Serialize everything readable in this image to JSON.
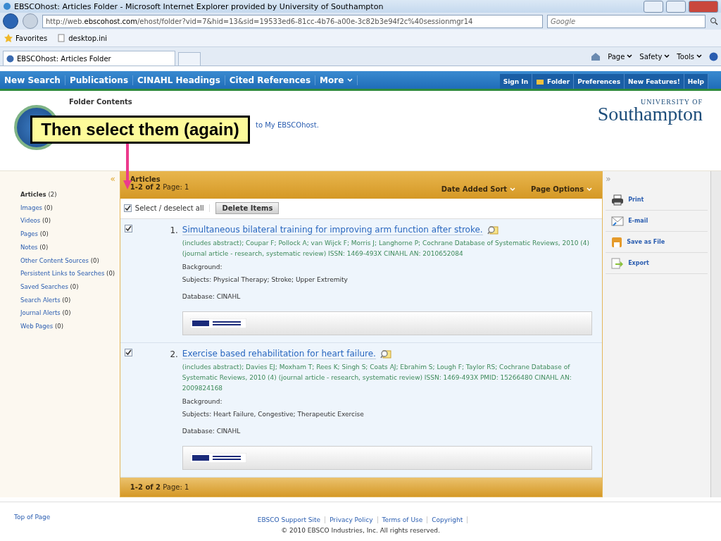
{
  "window": {
    "title": "EBSCOhost: Articles Folder - Microsoft Internet Explorer provided by University of Southampton"
  },
  "address_bar": {
    "url": "http://web.**ebscohost.com**/ehost/folder?vid=7&hid=13&sid=19533ed6-81cc-4b76-a00e-3c82b3e94f2c%40sessionmgr14"
  },
  "search_box": {
    "placeholder": "Google"
  },
  "favorites_bar": {
    "favorites": "Favorites",
    "items": [
      "desktop.ini"
    ]
  },
  "tab": {
    "label": "EBSCOhost: Articles Folder"
  },
  "command_bar": [
    "Page",
    "Safety",
    "Tools"
  ],
  "nav": {
    "items": [
      "New Search",
      "Publications",
      "CINAHL Headings",
      "Cited References",
      "More"
    ],
    "right_items": [
      {
        "label": "Sign In",
        "icon": false
      },
      {
        "label": "Folder",
        "icon": true
      },
      {
        "label": "Preferences",
        "icon": false
      },
      {
        "label": "New Features!",
        "icon": false
      },
      {
        "label": "Help",
        "icon": false
      }
    ]
  },
  "header": {
    "title": "Folder Contents",
    "text": "to My EBSCOhost.",
    "logo_top": "UNIVERSITY OF",
    "logo_name": "Southampton"
  },
  "callout": {
    "text": "Then select them (again)"
  },
  "sidebar": {
    "collapse": "«",
    "items": [
      {
        "label": "Articles",
        "count": "(2)",
        "selected": true
      },
      {
        "label": "Images",
        "count": "(0)",
        "selected": false
      },
      {
        "label": "Videos",
        "count": "(0)",
        "selected": false
      },
      {
        "label": "Pages",
        "count": "(0)",
        "selected": false
      },
      {
        "label": "Notes",
        "count": "(0)",
        "selected": false
      },
      {
        "label": "Other Content Sources",
        "count": "(0)",
        "selected": false
      },
      {
        "label": "Persistent Links to Searches",
        "count": "(0)",
        "selected": false
      },
      {
        "label": "Saved Searches",
        "count": "(0)",
        "selected": false
      },
      {
        "label": "Search Alerts",
        "count": "(0)",
        "selected": false
      },
      {
        "label": "Journal Alerts",
        "count": "(0)",
        "selected": false
      },
      {
        "label": "Web Pages",
        "count": "(0)",
        "selected": false
      }
    ]
  },
  "results": {
    "title": "Articles",
    "range": "**1-2 of 2** Page: 1",
    "sort": "Date Added Sort",
    "page_options": "Page Options",
    "select_all": {
      "label": "Select / deselect all",
      "checked": true
    },
    "delete": "Delete Items",
    "items": [
      {
        "number": "1.",
        "title": "Simultaneous bilateral training for improving arm function after stroke.",
        "checked": true,
        "meta": "(includes abstract); Coupar F; Pollock A; van Wijck F; Morris J; Langhorne P; Cochrane Database of Systematic Reviews, 2010 (4) (journal article - research, systematic review) ISSN: 1469-493X CINAHL AN: 2010652084",
        "background": "Background:",
        "subjects": "Subjects: Physical Therapy; Stroke; Upper Extremity",
        "database": "Database: CINAHL"
      },
      {
        "number": "2.",
        "title": "Exercise based rehabilitation for heart failure.",
        "checked": true,
        "meta": "(includes abstract); Davies EJ; Moxham T; Rees K; Singh S; Coats AJ; Ebrahim S; Lough F; Taylor RS; Cochrane Database of Systematic Reviews, 2010 (4) (journal article - research, systematic review) ISSN: 1469-493X PMID: 15266480 CINAHL AN: 2009824168",
        "background": "Background:",
        "subjects": "Subjects: Heart Failure, Congestive; Therapeutic Exercise",
        "database": "Database: CINAHL"
      }
    ],
    "footer_range": "**1-2 of 2** Page: 1"
  },
  "tools": {
    "expand": "»",
    "items": [
      {
        "label": "Print",
        "kind": "print"
      },
      {
        "label": "E-mail",
        "kind": "email"
      },
      {
        "label": "Save as File",
        "kind": "save"
      },
      {
        "label": "Export",
        "kind": "export"
      }
    ]
  },
  "footer": {
    "top": "Top of Page",
    "links": [
      "EBSCO Support Site",
      "Privacy Policy",
      "Terms of Use",
      "Copyright"
    ],
    "copyright": "© 2010 EBSCO Industries, Inc. All rights reserved."
  }
}
